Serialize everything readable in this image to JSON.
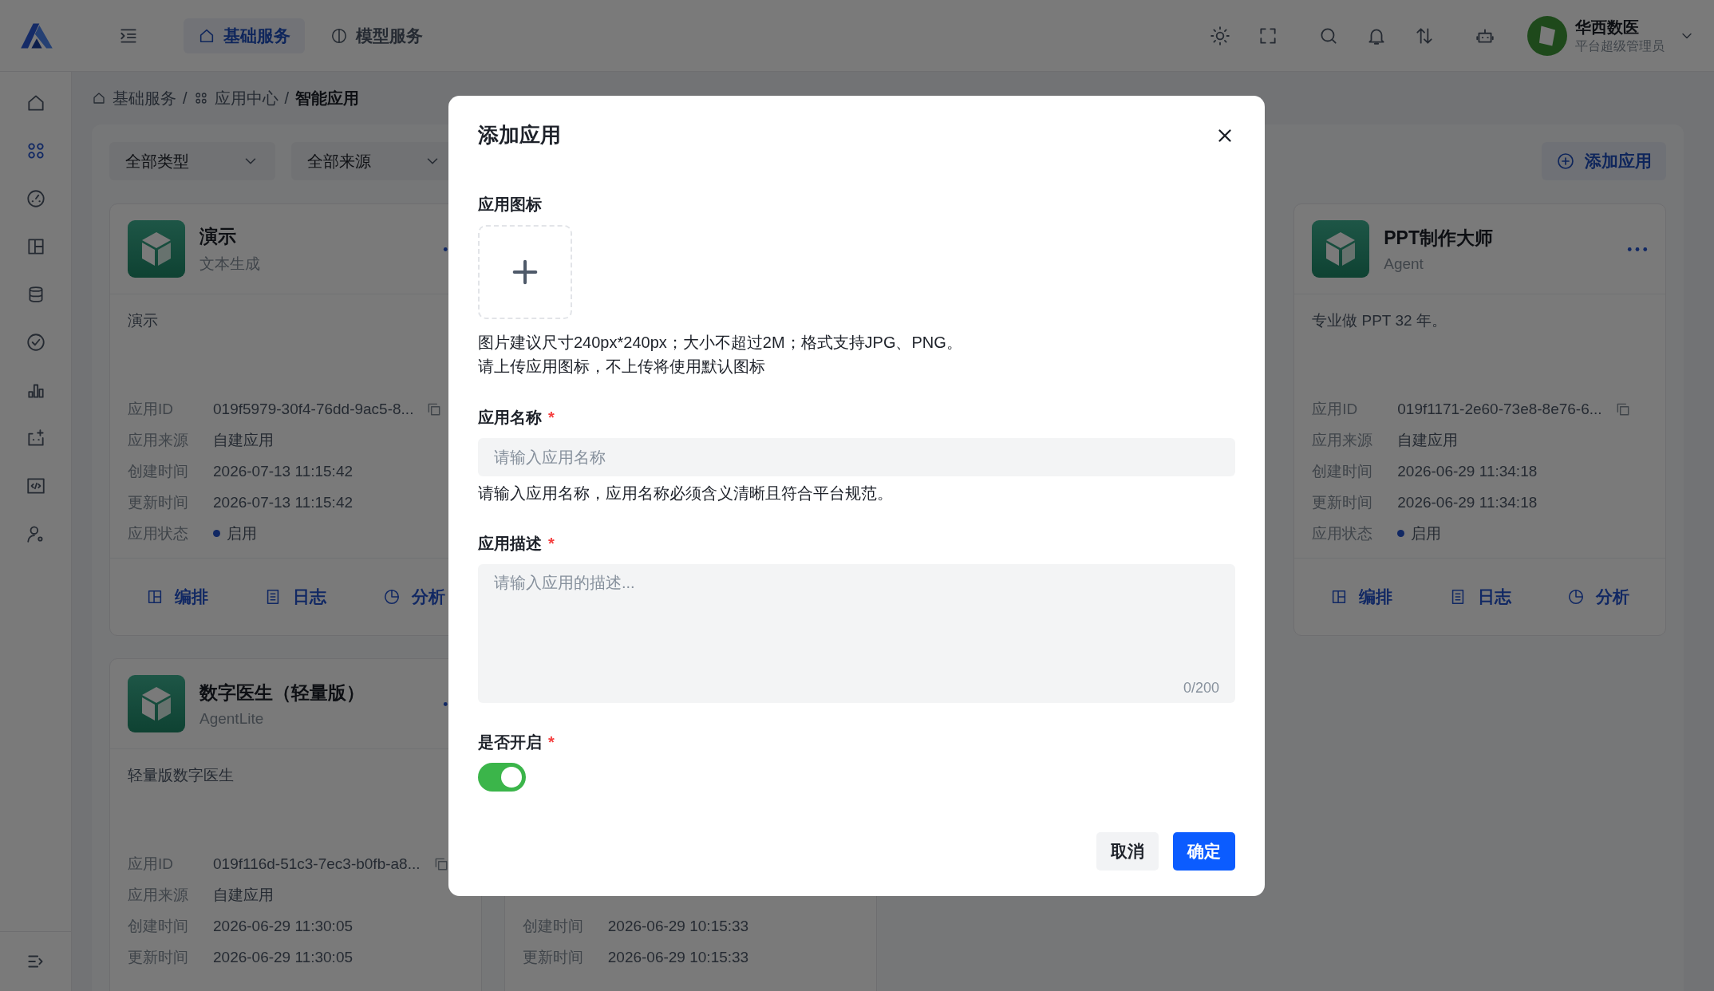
{
  "header": {
    "tabs": [
      {
        "label": "基础服务",
        "kind": "home",
        "selected": true
      },
      {
        "label": "模型服务",
        "kind": "model",
        "selected": false
      }
    ],
    "tools": [
      {
        "kind": "sun"
      },
      {
        "kind": "fullscreen"
      },
      {
        "kind": "search"
      },
      {
        "kind": "bell"
      },
      {
        "kind": "updown"
      },
      {
        "kind": "robot"
      }
    ],
    "user": {
      "name": "华西数医",
      "role": "平台超级管理员"
    }
  },
  "sidebar": {
    "items": [
      {
        "kind": "home",
        "selected": false
      },
      {
        "kind": "apps",
        "selected": true
      },
      {
        "kind": "gauge",
        "selected": false
      },
      {
        "kind": "layout",
        "selected": false
      },
      {
        "kind": "database",
        "selected": false
      },
      {
        "kind": "check",
        "selected": false
      },
      {
        "kind": "bars",
        "selected": false
      },
      {
        "kind": "bot",
        "selected": false
      },
      {
        "kind": "code",
        "selected": false
      },
      {
        "kind": "usergear",
        "selected": false
      }
    ]
  },
  "breadcrumb": [
    {
      "label": "基础服务",
      "kind": "home"
    },
    {
      "separator": "/",
      "label": "应用中心",
      "kind": "apps"
    },
    {
      "separator": "/",
      "label": "智能应用",
      "kind": "current"
    }
  ],
  "filters": [
    {
      "label": "全部类型"
    },
    {
      "label": "全部来源"
    }
  ],
  "add_button": "添加应用",
  "cards": [
    {
      "title": "演示",
      "subtitle": "文本生成",
      "description": "演示",
      "fields": [
        {
          "label": "应用ID",
          "value": "019f5979-30f4-76dd-9ac5-8...",
          "kind": "id"
        },
        {
          "label": "应用来源",
          "value": "自建应用",
          "kind": "text"
        },
        {
          "label": "创建时间",
          "value": "2026-07-13 11:15:42",
          "kind": "text"
        },
        {
          "label": "更新时间",
          "value": "2026-07-13 11:15:42",
          "kind": "text"
        },
        {
          "label": "应用状态",
          "value": "启用",
          "kind": "status"
        }
      ],
      "actions": [
        {
          "label": "编排",
          "kind": "layout"
        },
        {
          "label": "日志",
          "kind": "log"
        },
        {
          "label": "分析",
          "kind": "chart"
        }
      ]
    },
    {
      "title": "PPT制作大师",
      "subtitle": "Agent",
      "description": "专业做 PPT 32 年。",
      "fields": [
        {
          "label": "应用ID",
          "value": "019f1171-2e60-73e8-8e76-6...",
          "kind": "id"
        },
        {
          "label": "应用来源",
          "value": "自建应用",
          "kind": "text"
        },
        {
          "label": "创建时间",
          "value": "2026-06-29 11:34:18",
          "kind": "text"
        },
        {
          "label": "更新时间",
          "value": "2026-06-29 11:34:18",
          "kind": "text"
        },
        {
          "label": "应用状态",
          "value": "启用",
          "kind": "status"
        }
      ],
      "actions": [
        {
          "label": "编排",
          "kind": "layout"
        },
        {
          "label": "日志",
          "kind": "log"
        },
        {
          "label": "分析",
          "kind": "chart"
        }
      ]
    },
    {
      "title": "数字医生（轻量版）",
      "subtitle": "AgentLite",
      "description": "轻量版数字医生",
      "fields": [
        {
          "label": "应用ID",
          "value": "019f116d-51c3-7ec3-b0fb-a8...",
          "kind": "id"
        },
        {
          "label": "应用来源",
          "value": "自建应用",
          "kind": "text"
        },
        {
          "label": "创建时间",
          "value": "2026-06-29 11:30:05",
          "kind": "text"
        },
        {
          "label": "更新时间",
          "value": "2026-06-29 11:30:05",
          "kind": "text"
        }
      ]
    },
    {
      "fields": [
        {
          "label": "创建时间",
          "value": "2026-06-29 10:15:33",
          "kind": "text"
        },
        {
          "label": "更新时间",
          "value": "2026-06-29 10:15:33",
          "kind": "text"
        }
      ]
    }
  ],
  "dialog": {
    "title": "添加应用",
    "icon_label": "应用图标",
    "icon_hints": [
      "图片建议尺寸240px*240px；大小不超过2M；格式支持JPG、PNG。",
      "请上传应用图标，不上传将使用默认图标"
    ],
    "name_label": "应用名称",
    "name_placeholder": "请输入应用名称",
    "name_help": "请输入应用名称，应用名称必须含义清晰且符合平台规范。",
    "desc_label": "应用描述",
    "desc_placeholder": "请输入应用的描述...",
    "desc_count": "0/200",
    "enable_label": "是否开启",
    "enabled": true,
    "required_mark": "*",
    "buttons": [
      {
        "label": "取消",
        "kind": "secondary"
      },
      {
        "label": "确定",
        "kind": "primary"
      }
    ]
  }
}
